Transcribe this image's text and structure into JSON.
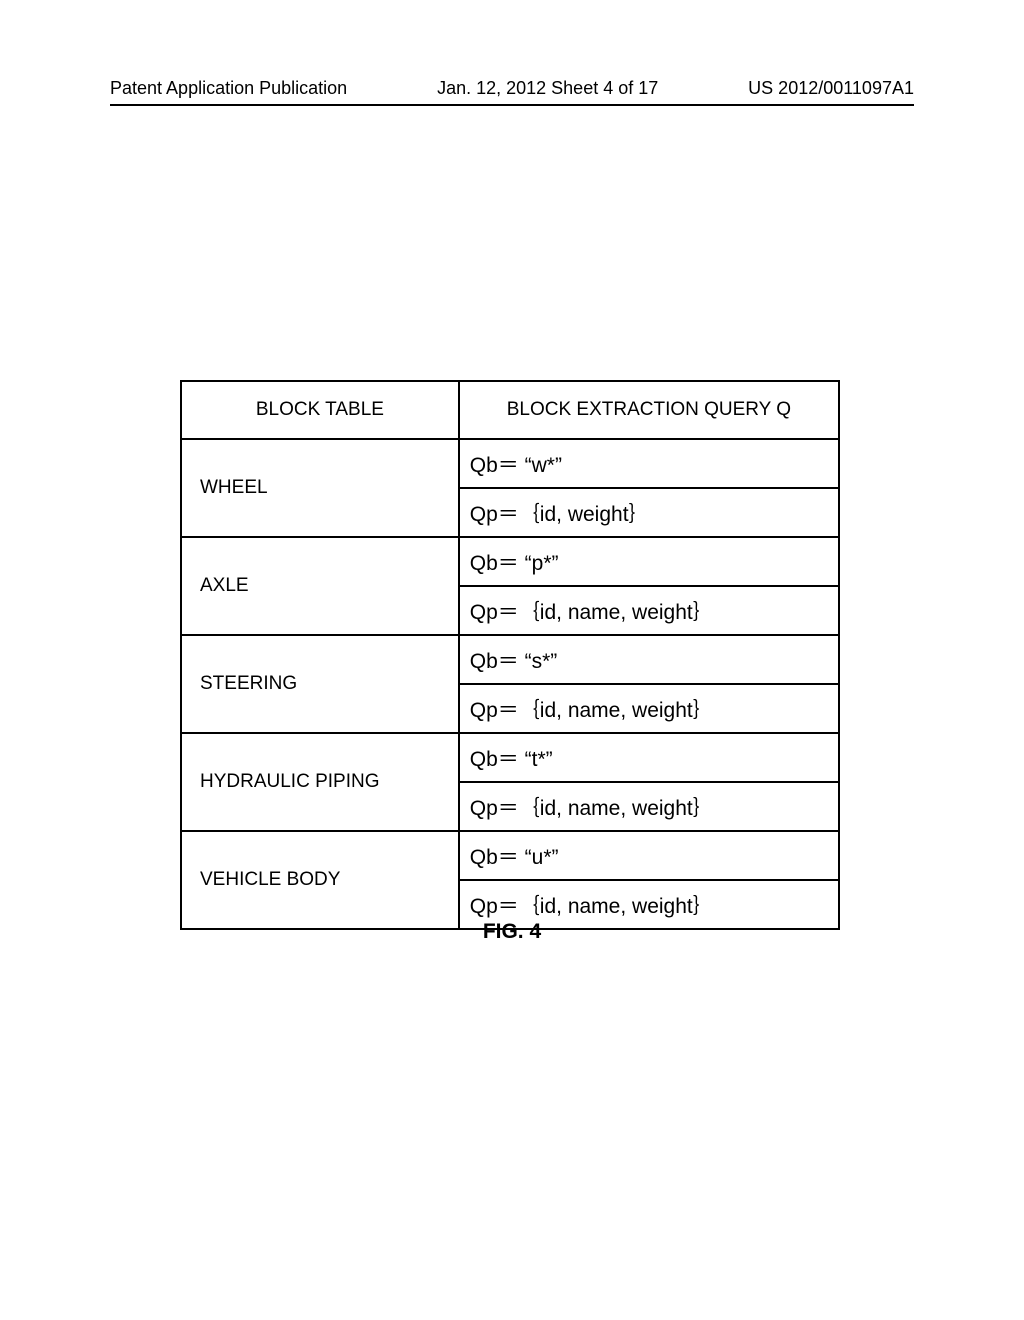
{
  "header": {
    "left": "Patent Application Publication",
    "mid": "Jan. 12, 2012  Sheet 4 of 17",
    "right": "US 2012/0011097A1"
  },
  "table": {
    "headers": {
      "block": "BLOCK TABLE",
      "query": "BLOCK EXTRACTION QUERY Q"
    },
    "rows": [
      {
        "name": "WHEEL",
        "qb": "Qb＝ “w*”",
        "qp": "Qp＝｛id, weight｝"
      },
      {
        "name": "AXLE",
        "qb": "Qb＝ “p*”",
        "qp": "Qp＝｛id, name, weight｝"
      },
      {
        "name": "STEERING",
        "qb": "Qb＝ “s*”",
        "qp": "Qp＝｛id, name, weight｝"
      },
      {
        "name": "HYDRAULIC PIPING",
        "qb": "Qb＝ “t*”",
        "qp": "Qp＝｛id, name, weight｝"
      },
      {
        "name": "VEHICLE BODY",
        "qb": "Qb＝ “u*”",
        "qp": "Qp＝｛id, name, weight｝"
      }
    ]
  },
  "figure_caption": "FIG. 4"
}
